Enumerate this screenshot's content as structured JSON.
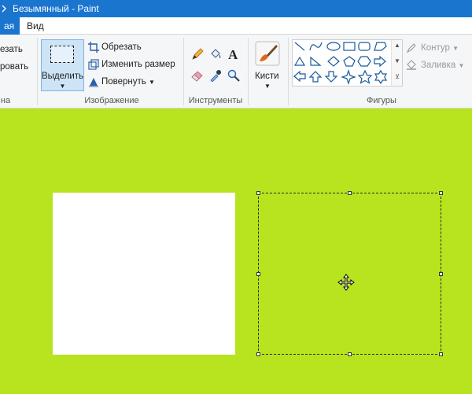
{
  "window": {
    "title": "Безымянный - Paint"
  },
  "tabs": {
    "home_partial": "ая",
    "view": "Вид"
  },
  "clipboard": {
    "cut_partial": "езать",
    "copy_partial": "ровать",
    "group_partial": "на"
  },
  "image": {
    "select_label": "Выделить",
    "crop_label": "Обрезать",
    "resize_label": "Изменить размер",
    "rotate_label": "Повернуть",
    "group_label": "Изображение"
  },
  "tools": {
    "group_label": "Инструменты",
    "icons": [
      "pencil-icon",
      "fill-icon",
      "text-icon",
      "eraser-icon",
      "color-picker-icon",
      "magnifier-icon"
    ]
  },
  "brushes": {
    "label": "Кисти"
  },
  "shapes": {
    "group_label": "Фигуры",
    "outline_label": "Контур",
    "fill_label": "Заливка"
  },
  "colors": {
    "canvas_background": "#b7e41e",
    "title_bar": "#1a75cf",
    "selection_highlight": "#cde4f7",
    "shape_stroke": "#1a5a9a"
  }
}
